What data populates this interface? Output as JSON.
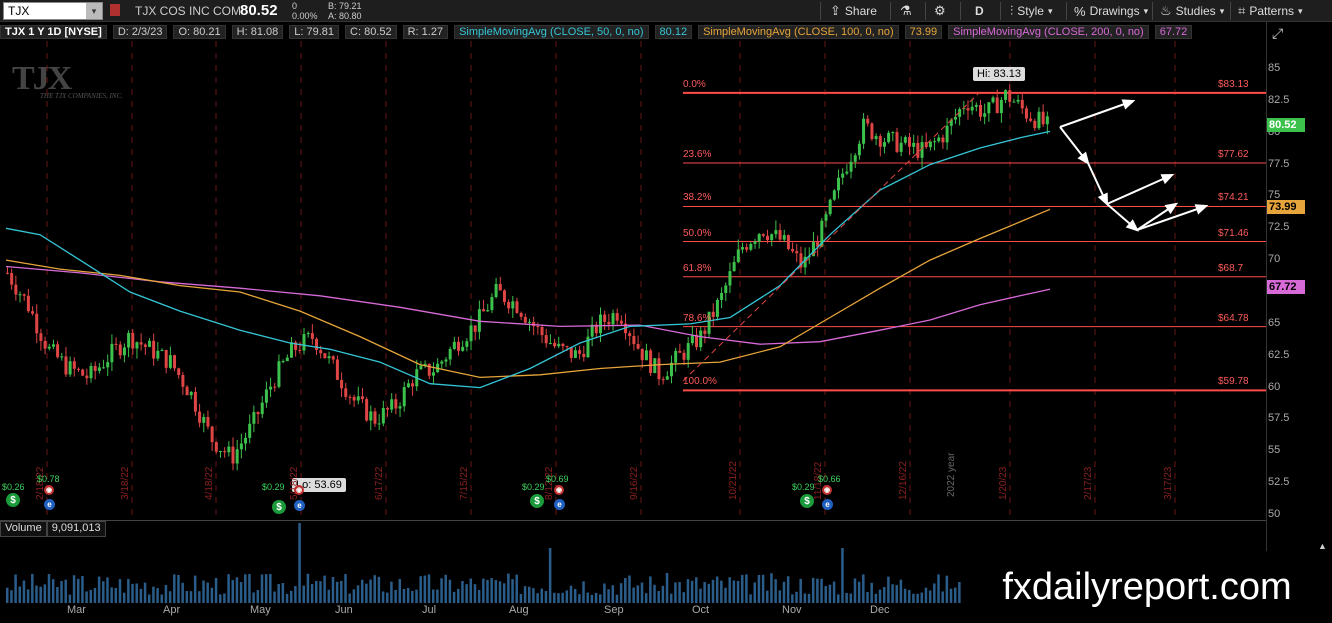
{
  "toolbar": {
    "symbol": "TJX",
    "company": "TJX COS INC COM",
    "last": "80.52",
    "change": "0",
    "change_pct": "0.00%",
    "bid": "B: 79.21",
    "ask": "A: 80.80",
    "share": "Share",
    "timeframe": "D",
    "style": "Style",
    "drawings": "Drawings",
    "studies": "Studies",
    "patterns": "Patterns"
  },
  "study_header": {
    "title": "TJX 1 Y 1D [NYSE]",
    "date": "D: 2/3/23",
    "open": "O: 80.21",
    "high": "H: 81.08",
    "low": "L: 79.81",
    "close": "C: 80.52",
    "range": "R: 1.27",
    "sma50": "SimpleMovingAvg (CLOSE, 50, 0, no)",
    "sma50_val": "80.12",
    "sma100": "SimpleMovingAvg (CLOSE, 100, 0, no)",
    "sma100_val": "73.99",
    "sma200": "SimpleMovingAvg (CLOSE, 200, 0, no)",
    "sma200_val": "67.72"
  },
  "logo": {
    "text": "TJX",
    "sub": "THE TJX COMPANIES, INC."
  },
  "price_axis": [
    "85",
    "82.5",
    "80",
    "77.5",
    "75",
    "72.5",
    "70",
    "67.5",
    "65",
    "62.5",
    "60",
    "57.5",
    "55",
    "52.5",
    "50"
  ],
  "price_tags": {
    "last": "80.52",
    "sma100": "73.99",
    "sma200": "67.72"
  },
  "fib": [
    {
      "pct": "0.0%",
      "price": "$83.13"
    },
    {
      "pct": "23.6%",
      "price": "$77.62"
    },
    {
      "pct": "38.2%",
      "price": "$74.21"
    },
    {
      "pct": "50.0%",
      "price": "$71.46"
    },
    {
      "pct": "61.8%",
      "price": "$68.7"
    },
    {
      "pct": "78.6%",
      "price": "$64.78"
    },
    {
      "pct": "100.0%",
      "price": "$59.78"
    }
  ],
  "hi_label": "Hi: 83.13",
  "lo_label": "Lo: 53.69",
  "events": [
    "$0.26",
    "$0.78",
    "$0.29",
    "$0.29",
    "$0.69",
    "$0.29",
    "$0.66"
  ],
  "date_markers": [
    "2/18/22",
    "3/18/22",
    "4/18/22",
    "5/18/22",
    "6/17/22",
    "7/15/22",
    "8/12/22",
    "9/16/22",
    "10/21/22",
    "11/18/22",
    "12/16/22",
    "1/20/23",
    "2/17/23",
    "3/17/23"
  ],
  "year_marker": "2022 year",
  "volume": {
    "label": "Volume",
    "value": "9,091,013"
  },
  "months": [
    "Mar",
    "Apr",
    "May",
    "Jun",
    "Jul",
    "Aug",
    "Sep",
    "Oct",
    "Nov",
    "Dec"
  ],
  "watermark": "fxdailyreport.com",
  "colors": {
    "sma50": "#34c6d6",
    "sma100": "#e6a53a",
    "sma200": "#d86ad8",
    "fib": "#ff4a4a",
    "up": "#3cc24c",
    "down": "#e04545"
  },
  "chart_data": {
    "type": "line",
    "note_series": "approximate daily closes",
    "series": [
      {
        "name": "TJX",
        "values": [
          69,
          66.5,
          63,
          61.5,
          60.8,
          62.5,
          64,
          63,
          62,
          59.5,
          56,
          54.5,
          57,
          60.5,
          63,
          64,
          61.5,
          59,
          57.5,
          58.5,
          61,
          61.5,
          63.5,
          65,
          67.5,
          66.5,
          64.5,
          63,
          62.5,
          65,
          66,
          63,
          61,
          62.5,
          64,
          67,
          71,
          72.5,
          71.5,
          69.5,
          72.5,
          77,
          80.5,
          79.5,
          79,
          78.5,
          80,
          82.5,
          81.5,
          83,
          81.5,
          80.5
        ]
      }
    ],
    "ylim": [
      50,
      86
    ]
  }
}
